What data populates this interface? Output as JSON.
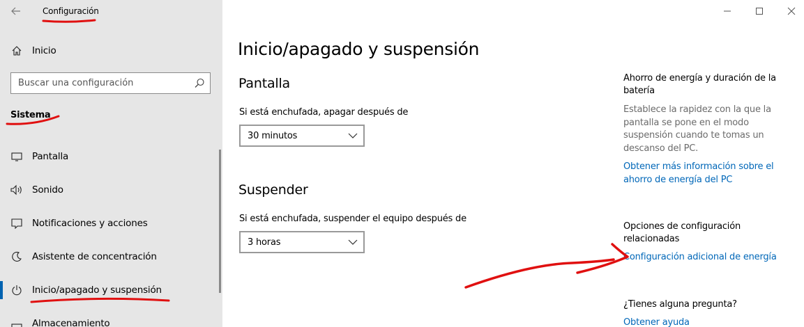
{
  "window": {
    "title": "Configuración",
    "controls": [
      "minimize-icon",
      "maximize-icon",
      "close-icon"
    ]
  },
  "sidebar": {
    "home_label": "Inicio",
    "search_placeholder": "Buscar una configuración",
    "section_title": "Sistema",
    "items": [
      {
        "label": "Pantalla",
        "icon": "monitor-icon"
      },
      {
        "label": "Sonido",
        "icon": "speaker-icon"
      },
      {
        "label": "Notificaciones y acciones",
        "icon": "notification-icon"
      },
      {
        "label": "Asistente de concentración",
        "icon": "moon-icon"
      },
      {
        "label": "Inicio/apagado y suspensión",
        "icon": "power-icon",
        "selected": true
      },
      {
        "label": "Almacenamiento",
        "icon": "storage-icon"
      }
    ]
  },
  "main": {
    "title": "Inicio/apagado y suspensión",
    "screen": {
      "heading": "Pantalla",
      "label": "Si está enchufada, apagar después de",
      "value": "30 minutos"
    },
    "sleep": {
      "heading": "Suspender",
      "label": "Si está enchufada, suspender el equipo después de",
      "value": "3 horas"
    }
  },
  "related": {
    "energy_heading": "Ahorro de energía y duración de la batería",
    "energy_text": "Establece la rapidez con la que la pantalla se pone en el modo suspensión cuando te tomas un descanso del PC.",
    "energy_link": "Obtener más información sobre el ahorro de energía del PC",
    "options_heading": "Opciones de configuración relacionadas",
    "options_link": "Configuración adicional de energía",
    "question_heading": "¿Tienes alguna pregunta?",
    "help_link": "Obtener ayuda"
  },
  "colors": {
    "accent": "#0063b1",
    "link": "#0067b8",
    "sidebar_bg": "#e6e6e6",
    "annotation": "#e01010"
  }
}
